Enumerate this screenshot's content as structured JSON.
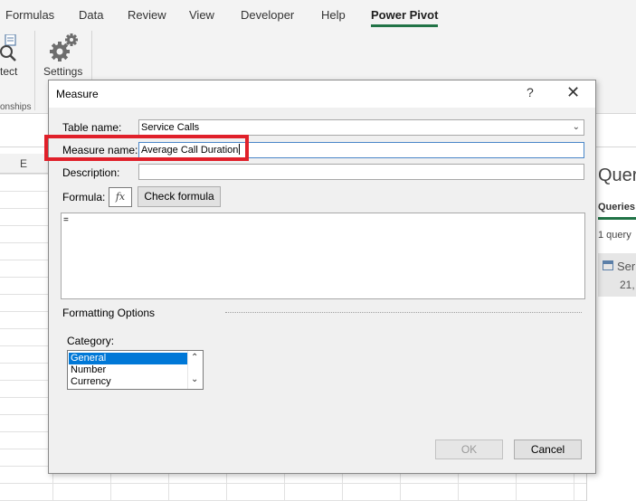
{
  "ribbon": {
    "tabs": [
      "Formulas",
      "Data",
      "Review",
      "View",
      "Developer",
      "Help",
      "Power Pivot"
    ],
    "active_tab": "Power Pivot",
    "detect_label": "tect",
    "settings_label": "Settings",
    "group_label": "onships"
  },
  "sheet": {
    "column_header": "E"
  },
  "queries_pane": {
    "title": "Quer",
    "tab": "Queries",
    "count": "1 query",
    "item_name": "Ser",
    "item_rows": "21,"
  },
  "dialog": {
    "title": "Measure",
    "help_glyph": "?",
    "close_glyph": "✕",
    "table_name_label": "Table name:",
    "table_name_value": "Service Calls",
    "measure_name_label": "Measure name:",
    "measure_name_value": "Average Call Duration",
    "description_label": "Description:",
    "description_value": "",
    "formula_label": "Formula:",
    "fx_label": "fx",
    "check_formula_label": "Check formula",
    "formula_value": "=",
    "formatting_options_label": "Formatting Options",
    "category_label": "Category:",
    "category_options": [
      "General",
      "Number",
      "Currency"
    ],
    "selected_category": "General",
    "ok_label": "OK",
    "cancel_label": "Cancel"
  },
  "colors": {
    "accent_green": "#217346",
    "selection_blue": "#0078d7",
    "highlight_red": "#e0202a"
  }
}
